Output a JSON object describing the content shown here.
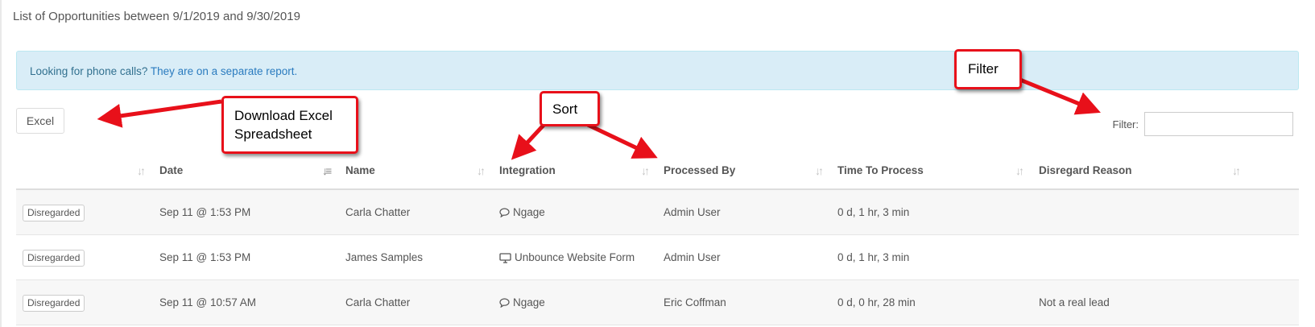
{
  "page": {
    "title": "List of Opportunities between 9/1/2019 and 9/30/2019"
  },
  "alert": {
    "text": "Looking for phone calls?",
    "link": "They are on a separate report."
  },
  "toolbar": {
    "excel_label": "Excel"
  },
  "filter": {
    "label": "Filter:",
    "value": "",
    "placeholder": ""
  },
  "table": {
    "columns": [
      "",
      "Date",
      "Name",
      "Integration",
      "Processed By",
      "Time To Process",
      "Disregard Reason"
    ],
    "active_sort_column": "Date",
    "rows": [
      {
        "status": "Disregarded",
        "date": "Sep 11 @ 1:53 PM",
        "name": "Carla Chatter",
        "integration_icon": "chat-bubble-icon",
        "integration": "Ngage",
        "processed_by": "Admin User",
        "time_to_process": "0 d, 1 hr, 3 min",
        "disregard_reason": ""
      },
      {
        "status": "Disregarded",
        "date": "Sep 11 @ 1:53 PM",
        "name": "James Samples",
        "integration_icon": "monitor-icon",
        "integration": "Unbounce Website Form",
        "processed_by": "Admin User",
        "time_to_process": "0 d, 1 hr, 3 min",
        "disregard_reason": ""
      },
      {
        "status": "Disregarded",
        "date": "Sep 11 @ 10:57 AM",
        "name": "Carla Chatter",
        "integration_icon": "chat-bubble-icon",
        "integration": "Ngage",
        "processed_by": "Eric Coffman",
        "time_to_process": "0 d, 0 hr, 28 min",
        "disregard_reason": "Not a real lead"
      }
    ]
  },
  "annotations": {
    "download": {
      "line1": "Download Excel",
      "line2": "Spreadsheet"
    },
    "sort": "Sort",
    "filter": "Filter"
  },
  "colors": {
    "alert_bg": "#d9edf7",
    "alert_link": "#2a7bbf",
    "annotation_red": "#e8101a"
  }
}
